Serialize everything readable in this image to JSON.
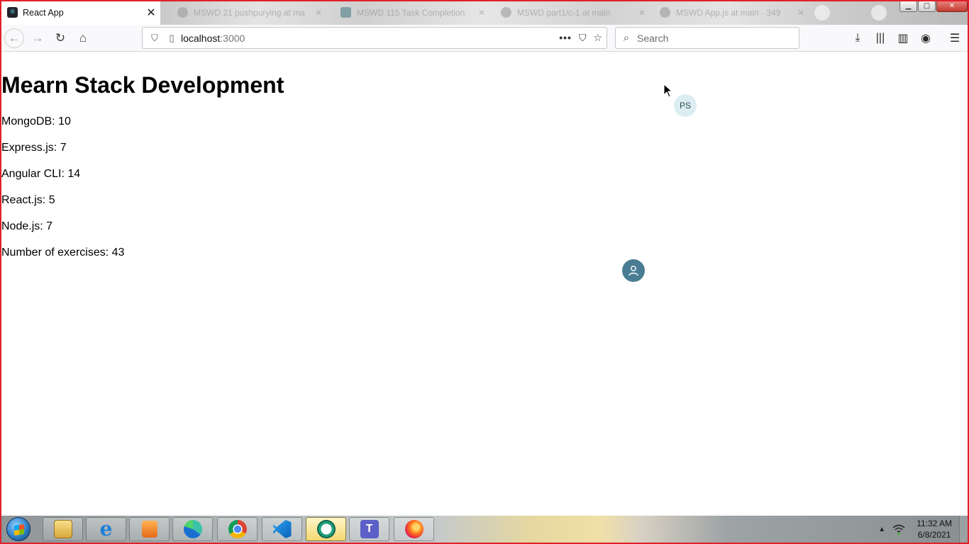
{
  "browser": {
    "active_tab": {
      "title": "React App"
    },
    "bg_tabs": [
      {
        "title": "MSWD 21 pushpurying at ma"
      },
      {
        "title": "MSWD 115 Task Completion"
      },
      {
        "title": "MSWD part1/c-1 at main"
      },
      {
        "title": "MSWD App.js at main · 349"
      }
    ],
    "url_host": "localhost",
    "url_port": ":3000",
    "search_placeholder": "Search"
  },
  "page": {
    "heading": "Mearn Stack Development",
    "lines": [
      "MongoDB: 10",
      "Express.js: 7",
      "Angular CLI: 14",
      "React.js: 5",
      "Node.js: 7",
      "Number of exercises: 43"
    ],
    "avatar_initials": "PS"
  },
  "taskbar": {
    "apps": [
      "windows-explorer",
      "internet-explorer",
      "media-player",
      "edge",
      "chrome",
      "vscode",
      "camtasia",
      "teams",
      "firefox"
    ],
    "time": "11:32 AM",
    "date": "6/8/2021"
  }
}
